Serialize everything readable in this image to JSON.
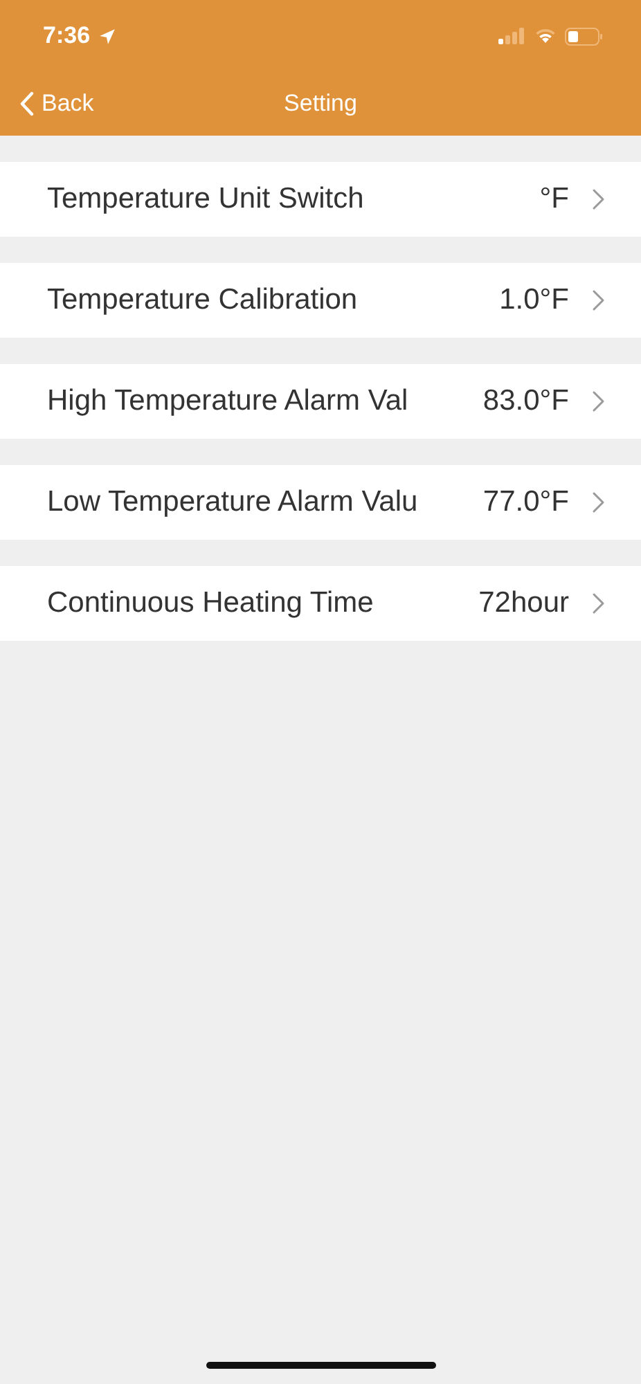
{
  "status_bar": {
    "time": "7:36"
  },
  "nav": {
    "back": "Back",
    "title": "Setting"
  },
  "rows": [
    {
      "label": "Temperature Unit Switch",
      "value": "°F"
    },
    {
      "label": "Temperature Calibration",
      "value": "1.0°F"
    },
    {
      "label": "High Temperature Alarm Val",
      "value": "83.0°F"
    },
    {
      "label": "Low Temperature Alarm Valu",
      "value": "77.0°F"
    },
    {
      "label": "Continuous Heating Time",
      "value": "72hour"
    }
  ]
}
